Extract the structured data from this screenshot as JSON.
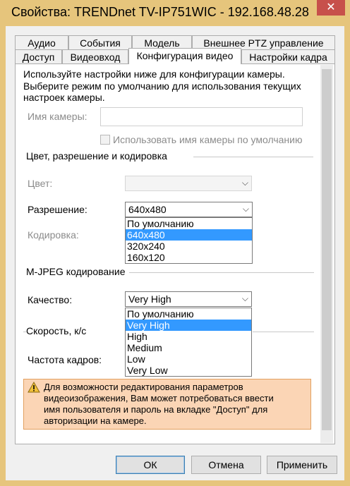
{
  "window": {
    "title": "Свойства: TRENDnet TV-IP751WIC - 192.168.48.28",
    "close_glyph": "✕"
  },
  "tabs": {
    "row1": [
      "Аудио",
      "События",
      "Модель",
      "Внешнее PTZ управление"
    ],
    "row2": [
      "Доступ",
      "Видеовход",
      "Конфигурация видео",
      "Настройки кадра"
    ],
    "active": "Конфигурация видео"
  },
  "intro": {
    "line1": "Используйте настройки ниже для конфигурации камеры.",
    "line2": "Выберите режим по умолчанию для использования текущих",
    "line3": "настроек камеры."
  },
  "camera_name": {
    "label": "Имя камеры:",
    "value": "",
    "checkbox_label": "Использовать имя камеры по умолчанию",
    "checked": false
  },
  "section_color": {
    "title": "Цвет, разрешение и кодировка"
  },
  "color": {
    "label": "Цвет:",
    "value": ""
  },
  "resolution": {
    "label": "Разрешение:",
    "value": "640x480",
    "options": [
      "По умолчанию",
      "640x480",
      "320x240",
      "160x120"
    ],
    "selected_index": 1
  },
  "encoding": {
    "label": "Кодировка:"
  },
  "section_mjpeg": {
    "title": "M-JPEG кодирование"
  },
  "quality": {
    "label": "Качество:",
    "value": "Very High",
    "options": [
      "По умолчанию",
      "Very High",
      "High",
      "Medium",
      "Low",
      "Very Low"
    ],
    "selected_index": 1
  },
  "section_speed": {
    "title": "Скорость, к/с"
  },
  "framerate": {
    "label": "Частота кадров:"
  },
  "warning": {
    "line1": "Для возможности редактирования параметров",
    "line2": "видеоизображения, Вам может потребоваться ввести",
    "line3": "имя пользователя и пароль на вкладке \"Доступ\" для",
    "line4": "авторизации на камере."
  },
  "buttons": {
    "ok": "ОК",
    "cancel": "Отмена",
    "apply": "Применить"
  },
  "colors": {
    "frame": "#e6c57c",
    "selection": "#3399ff",
    "warning_bg": "#fbd5b5",
    "close": "#c7504b"
  }
}
